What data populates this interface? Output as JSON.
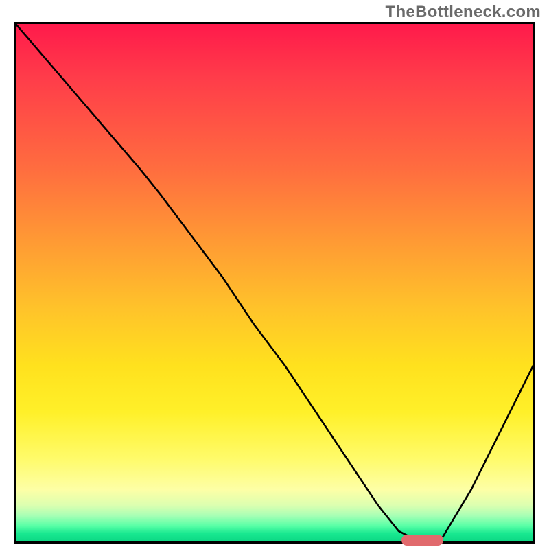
{
  "watermark": "TheBottleneck.com",
  "colors": {
    "frame_border": "#000000",
    "gradient_top": "#ff1a4b",
    "gradient_bottom": "#0cd884",
    "curve": "#000000",
    "marker": "#e16a6d",
    "watermark_text": "#6a6a6a"
  },
  "chart_data": {
    "type": "line",
    "title": "",
    "xlabel": "",
    "ylabel": "",
    "xlim": [
      0,
      100
    ],
    "ylim": [
      0,
      100
    ],
    "grid": false,
    "series": [
      {
        "name": "curve",
        "x": [
          0,
          6,
          12,
          18,
          24,
          28,
          34,
          40,
          46,
          52,
          58,
          64,
          70,
          74,
          78,
          82,
          88,
          94,
          100
        ],
        "y": [
          100,
          93,
          86,
          79,
          72,
          67,
          59,
          51,
          42,
          34,
          25,
          16,
          7,
          2,
          0,
          0,
          10,
          22,
          34
        ]
      }
    ],
    "annotations": [
      {
        "name": "optimal-marker",
        "x_range": [
          74,
          82
        ],
        "y": 0
      }
    ],
    "background": {
      "type": "vertical-gradient",
      "stops": [
        {
          "pos": 0.0,
          "color": "#ff1a4b"
        },
        {
          "pos": 0.28,
          "color": "#ff6d3f"
        },
        {
          "pos": 0.55,
          "color": "#ffc32a"
        },
        {
          "pos": 0.75,
          "color": "#fff029"
        },
        {
          "pos": 0.93,
          "color": "#dcffb0"
        },
        {
          "pos": 1.0,
          "color": "#0cd884"
        }
      ]
    }
  }
}
